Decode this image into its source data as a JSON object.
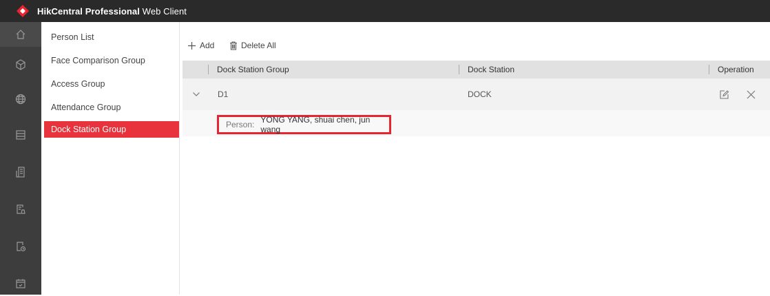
{
  "app": {
    "title_bold": "HikCentral Professional",
    "title_rest": " Web Client",
    "brand_color": "#e5252f"
  },
  "leftnav": {
    "icons": [
      "home-icon",
      "cube-icon",
      "globe-icon",
      "server-icon",
      "building-icon",
      "document-search-icon",
      "document-clock-icon",
      "calendar-icon"
    ]
  },
  "subnav": {
    "items": [
      {
        "label": "Person List"
      },
      {
        "label": "Face Comparison Group"
      },
      {
        "label": "Access Group"
      },
      {
        "label": "Attendance Group"
      },
      {
        "label": "Dock Station Group"
      }
    ],
    "active_index": 4
  },
  "toolbar": {
    "add_label": "Add",
    "delete_all_label": "Delete All"
  },
  "table": {
    "headers": [
      "Dock Station Group",
      "Dock Station",
      "Operation"
    ],
    "rows": [
      {
        "group": "D1",
        "station": "DOCK"
      }
    ],
    "detail": {
      "person_label": "Person:",
      "person_value": "YONG YANG, shuai chen, jun wang"
    }
  }
}
